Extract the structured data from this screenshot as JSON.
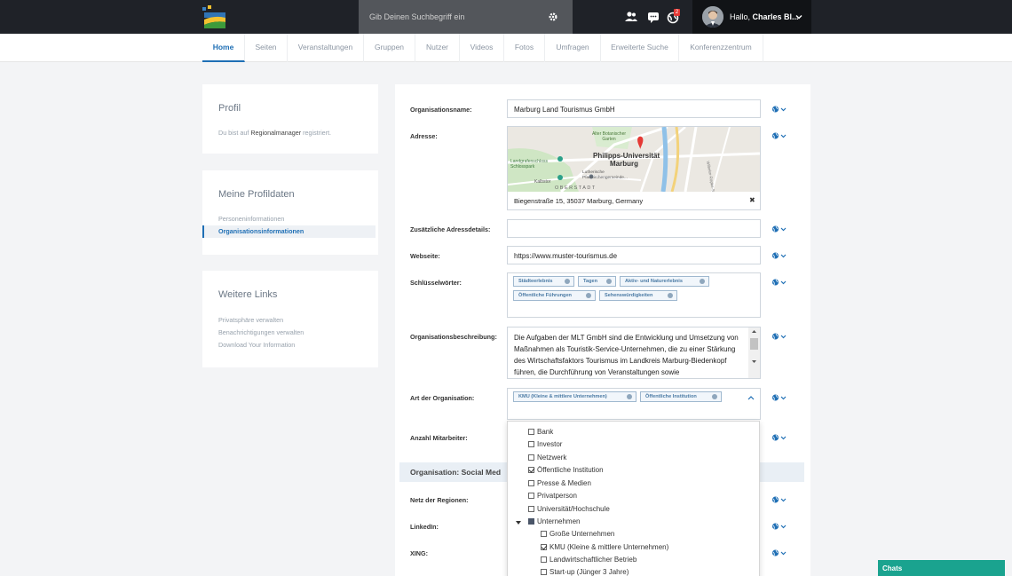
{
  "topbar": {
    "search_placeholder": "Gib Deinen Suchbegriff ein",
    "notification_count": "2",
    "greeting": "Hallo,",
    "user_name": "Charles Bl..."
  },
  "nav": {
    "items": [
      {
        "label": "Home",
        "active": true
      },
      {
        "label": "Seiten"
      },
      {
        "label": "Veranstaltungen"
      },
      {
        "label": "Gruppen"
      },
      {
        "label": "Nutzer"
      },
      {
        "label": "Videos"
      },
      {
        "label": "Fotos"
      },
      {
        "label": "Umfragen"
      },
      {
        "label": "Erweiterte Suche"
      },
      {
        "label": "Konferenzzentrum"
      }
    ]
  },
  "sidebar": {
    "profil": {
      "title": "Profil",
      "text_before": "Du bist auf ",
      "text_bold": "Regionalmanager",
      "text_after": " registriert."
    },
    "profildaten": {
      "title": "Meine Profildaten",
      "items": [
        "Personeninformationen",
        "Organisationsinformationen"
      ]
    },
    "links": {
      "title": "Weitere Links",
      "items": [
        "Privatsphäre verwalten",
        "Benachrichtigungen verwalten",
        "Download Your Information"
      ]
    }
  },
  "form": {
    "org_name_label": "Organisationsname:",
    "org_name_value": "Marburg Land Tourismus GmbH",
    "address_label": "Adresse:",
    "address_value": "Biegenstraße 15, 35037 Marburg, Germany",
    "address_clear": "✖",
    "map": {
      "place_main": "Philipps-Universität",
      "place_sub": "Marburg",
      "place_garden": "Alter Botanischer Garten",
      "place_park": "Landgrafenschloss Schlosspark",
      "place_church": "Lutherische Pfarrkirchengemeinde...",
      "place_kalbstor": "Kalbstor",
      "district": "OBERSTADT",
      "street": "Wilhelm-Röpke-Str."
    },
    "extra_address_label": "Zusätzliche Adressdetails:",
    "website_label": "Webseite:",
    "website_value": "https://www.muster-tourismus.de",
    "keywords_label": "Schlüsselwörter:",
    "keywords": [
      "Städteerlebnis",
      "Tagen",
      "Aktiv- und Naturerlebnis",
      "Öffentliche Führungen",
      "Sehenswürdigkeiten"
    ],
    "description_label": "Organisationsbeschreibung:",
    "description_value": "Die Aufgaben der MLT GmbH sind die Entwicklung und Umsetzung von Maßnahmen als Touristik-Service-Unternehmen, die zu einer Stärkung des Wirtschaftsfaktors Tourismus im Landkreis Marburg-Biedenkopf führen, die Durchführung von Veranstaltungen sowie",
    "org_type_label": "Art der Organisation:",
    "org_type_tags": [
      "KMU (Kleine & mittlere Unternehmen)",
      "Öffentliche Institution"
    ],
    "employees_label": "Anzahl Mitarbeiter:",
    "section_title": "Organisation: Social Med",
    "regions_label": "Netz der Regionen:",
    "linkedin_label": "LinkedIn:",
    "xing_label": "XING:"
  },
  "dropdown": {
    "options": [
      {
        "label": "Bank",
        "state": "unchecked",
        "level": 0
      },
      {
        "label": "Investor",
        "state": "unchecked",
        "level": 0
      },
      {
        "label": "Netzwerk",
        "state": "unchecked",
        "level": 0
      },
      {
        "label": "Öffentliche Institution",
        "state": "checked",
        "level": 0
      },
      {
        "label": "Presse & Medien",
        "state": "unchecked",
        "level": 0
      },
      {
        "label": "Privatperson",
        "state": "unchecked",
        "level": 0
      },
      {
        "label": "Universität/Hochschule",
        "state": "unchecked",
        "level": 0
      },
      {
        "label": "Unternehmen",
        "state": "partial",
        "level": 0,
        "expanded": true
      },
      {
        "label": "Große Unternehmen",
        "state": "unchecked",
        "level": 1
      },
      {
        "label": "KMU (Kleine & mittlere Unternehmen)",
        "state": "checked",
        "level": 1
      },
      {
        "label": "Landwirtschaftlicher Betrieb",
        "state": "unchecked",
        "level": 1
      },
      {
        "label": "Start-up (Jünger 3 Jahre)",
        "state": "unchecked",
        "level": 1
      }
    ]
  },
  "chats": {
    "label": "Chats"
  },
  "colors": {
    "accent": "#1f6fb5",
    "topbar": "#1f2228",
    "chats": "#1aa38f"
  }
}
